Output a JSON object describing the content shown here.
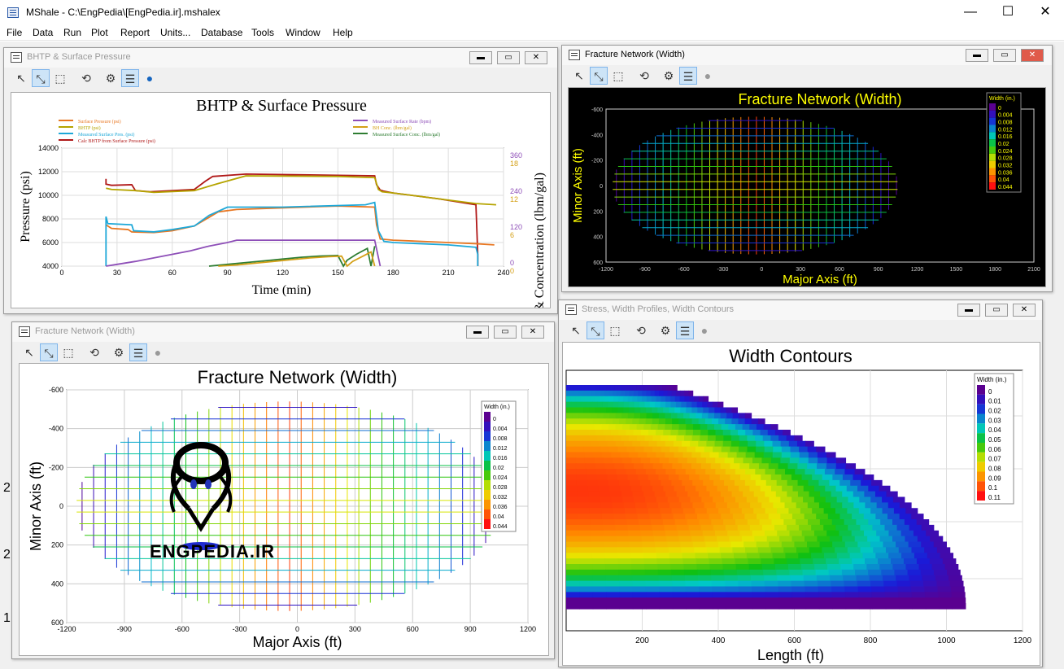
{
  "app": {
    "title": "MShale - C:\\EngPedia\\[EngPedia.ir].mshalex",
    "minimize": "—",
    "maximize": "☐",
    "close": "✕"
  },
  "menu": [
    "File",
    "Data",
    "Run",
    "Plot",
    "Report",
    "Units...",
    "Database",
    "Tools",
    "Window",
    "Help"
  ],
  "windows": {
    "bhtp": {
      "title": "BHTP & Surface Pressure"
    },
    "fn_top": {
      "title": "Fracture Network (Width)"
    },
    "fn_bottom": {
      "title": "Fracture Network (Width)"
    },
    "stress": {
      "title": "Stress, Width Profiles, Width Contours"
    }
  },
  "background_numbers": [
    "2",
    "2",
    "1"
  ],
  "watermark": {
    "text": "ENGPEDIA.IR"
  },
  "chart_data": [
    {
      "id": "bhtp",
      "type": "line",
      "title": "BHTP & Surface Pressure",
      "xlabel": "Time (min)",
      "ylabel": "Pressure (psi)",
      "y2label": "Rate & Concentration (lbm/gal)",
      "xlim": [
        0,
        240
      ],
      "ylim": [
        4000,
        14000
      ],
      "x_ticks": [
        "0",
        "30",
        "60",
        "90",
        "120",
        "150",
        "180",
        "210",
        "240"
      ],
      "y_ticks": [
        "4000",
        "6000",
        "8000",
        "10000",
        "12000",
        "14000"
      ],
      "y2_ticks_a": [
        "360",
        "240",
        "120",
        "0"
      ],
      "y2_ticks_b": [
        "18",
        "12",
        "6",
        "0"
      ],
      "legend": [
        {
          "name": "Surface Pressure (psi)",
          "color": "#e87722"
        },
        {
          "name": "BHTP (psi)",
          "color": "#b5a400"
        },
        {
          "name": "Measured Surface Pres. (psi)",
          "color": "#1ea8d8"
        },
        {
          "name": "Calc BHTP from Surface Pressure (psi)",
          "color": "#b01818"
        },
        {
          "name": "Measured Surface Rate (bpm)",
          "color": "#8e4fb8"
        },
        {
          "name": "BH Conc. (lbm/gal)",
          "color": "#d4a017"
        },
        {
          "name": "Measured Surface Conc. (lbm/gal)",
          "color": "#2e7d32"
        }
      ],
      "series": [
        {
          "name": "Calc BHTP from Surface Pressure (psi)",
          "color": "#b01818",
          "x": [
            24,
            24,
            27,
            38,
            40,
            48,
            72,
            78,
            82,
            100,
            150,
            170,
            171,
            173,
            175,
            180,
            205,
            225,
            226,
            226
          ],
          "y": [
            11400,
            10950,
            10850,
            10900,
            10400,
            10300,
            10500,
            11200,
            11600,
            11800,
            11700,
            11650,
            10900,
            10450,
            10350,
            10200,
            9700,
            9200,
            5000,
            4000
          ]
        },
        {
          "name": "Surface Pressure (psi)",
          "color": "#e87722",
          "x": [
            24,
            27,
            36,
            38,
            50,
            60,
            72,
            85,
            95,
            150,
            170,
            171,
            173,
            180,
            210,
            225,
            235
          ],
          "y": [
            7500,
            7200,
            7100,
            6900,
            6850,
            7000,
            7400,
            8600,
            8800,
            9100,
            9000,
            7500,
            6300,
            6200,
            6000,
            5900,
            5800
          ]
        },
        {
          "name": "Measured Surface Pres. (psi)",
          "color": "#1ea8d8",
          "x": [
            24,
            24,
            25,
            38,
            39,
            50,
            60,
            72,
            80,
            90,
            120,
            165,
            170,
            172,
            175,
            180,
            210,
            225,
            226,
            226
          ],
          "y": [
            4000,
            8200,
            7600,
            7500,
            7000,
            6900,
            7100,
            7400,
            8300,
            9000,
            9000,
            9200,
            9400,
            7000,
            6100,
            6000,
            5800,
            5600,
            5000,
            4000
          ]
        },
        {
          "name": "BHTP (psi)",
          "color": "#b5a400",
          "x": [
            24,
            27,
            40,
            50,
            72,
            85,
            100,
            150,
            170,
            172,
            174,
            180,
            205,
            225,
            236
          ],
          "y": [
            10600,
            10500,
            10400,
            10250,
            10400,
            11000,
            11650,
            11600,
            11500,
            10500,
            10300,
            10200,
            9700,
            9300,
            9200
          ]
        },
        {
          "name": "Measured Surface Rate (bpm)",
          "color": "#8e4fb8",
          "x": [
            24,
            30,
            40,
            50,
            60,
            70,
            80,
            90,
            95,
            170,
            173
          ],
          "y": [
            4000,
            4150,
            4400,
            4700,
            5000,
            5300,
            5700,
            6000,
            6200,
            6200,
            4000
          ]
        },
        {
          "name": "Measured Surface Conc. (lbm/gal)",
          "color": "#2e7d32",
          "x": [
            80,
            90,
            100,
            110,
            120,
            130,
            140,
            150,
            153,
            155,
            160,
            166,
            168,
            170
          ],
          "y": [
            4000,
            4150,
            4300,
            4450,
            4600,
            4750,
            4850,
            4900,
            4000,
            4500,
            5000,
            5500,
            4000,
            5700
          ]
        },
        {
          "name": "BH Conc. (lbm/gal)",
          "color": "#d4a017",
          "x": [
            85,
            95,
            105,
            115,
            125,
            135,
            145,
            152,
            155,
            158,
            163,
            168,
            170
          ],
          "y": [
            4000,
            4100,
            4250,
            4400,
            4550,
            4700,
            4800,
            4850,
            4000,
            4400,
            4800,
            5200,
            4000
          ]
        }
      ]
    },
    {
      "id": "fn_top",
      "type": "heatmap",
      "title": "Fracture Network (Width)",
      "xlabel": "Major Axis (ft)",
      "ylabel": "Minor Axis (ft)",
      "xlim": [
        -1200,
        2100
      ],
      "ylim": [
        600,
        -600
      ],
      "x_ticks": [
        "-1200",
        "-900",
        "-600",
        "-300",
        "0",
        "300",
        "600",
        "900",
        "1200",
        "1500",
        "1800",
        "2100"
      ],
      "y_ticks": [
        "-600",
        "-400",
        "-200",
        "0",
        "200",
        "400",
        "600"
      ],
      "legend_title": "Width (in.)",
      "legend_values": [
        "0",
        "0.004",
        "0.008",
        "0.012",
        "0.016",
        "0.02",
        "0.024",
        "0.028",
        "0.032",
        "0.036",
        "0.04",
        "0.044"
      ],
      "ellipse": {
        "cx": -50,
        "cy": 0,
        "rx": 1100,
        "ry": 540
      }
    },
    {
      "id": "fn_bottom",
      "type": "heatmap",
      "title": "Fracture Network (Width)",
      "xlabel": "Major Axis (ft)",
      "ylabel": "Minor Axis (ft)",
      "xlim": [
        -1200,
        1200
      ],
      "ylim": [
        600,
        -600
      ],
      "x_ticks": [
        "-1200",
        "-900",
        "-600",
        "-300",
        "0",
        "300",
        "600",
        "900",
        "1200"
      ],
      "y_ticks": [
        "-600",
        "-400",
        "-200",
        "0",
        "200",
        "400",
        "600"
      ],
      "legend_title": "Width (in.)",
      "legend_values": [
        "0",
        "0.004",
        "0.008",
        "0.012",
        "0.016",
        "0.02",
        "0.024",
        "0.028",
        "0.032",
        "0.036",
        "0.04",
        "0.044"
      ],
      "ellipse": {
        "cx": -50,
        "cy": 0,
        "rx": 1100,
        "ry": 540
      }
    },
    {
      "id": "contours",
      "type": "heatmap",
      "title": "Width Contours",
      "xlabel": "Length (ft)",
      "xlim": [
        0,
        1200
      ],
      "x_ticks": [
        "200",
        "400",
        "600",
        "800",
        "1000",
        "1200"
      ],
      "legend_title": "Width (in.)",
      "legend_values": [
        "0",
        "0.01",
        "0.02",
        "0.03",
        "0.04",
        "0.05",
        "0.06",
        "0.07",
        "0.08",
        "0.09",
        "0.1",
        "0.11"
      ]
    }
  ]
}
